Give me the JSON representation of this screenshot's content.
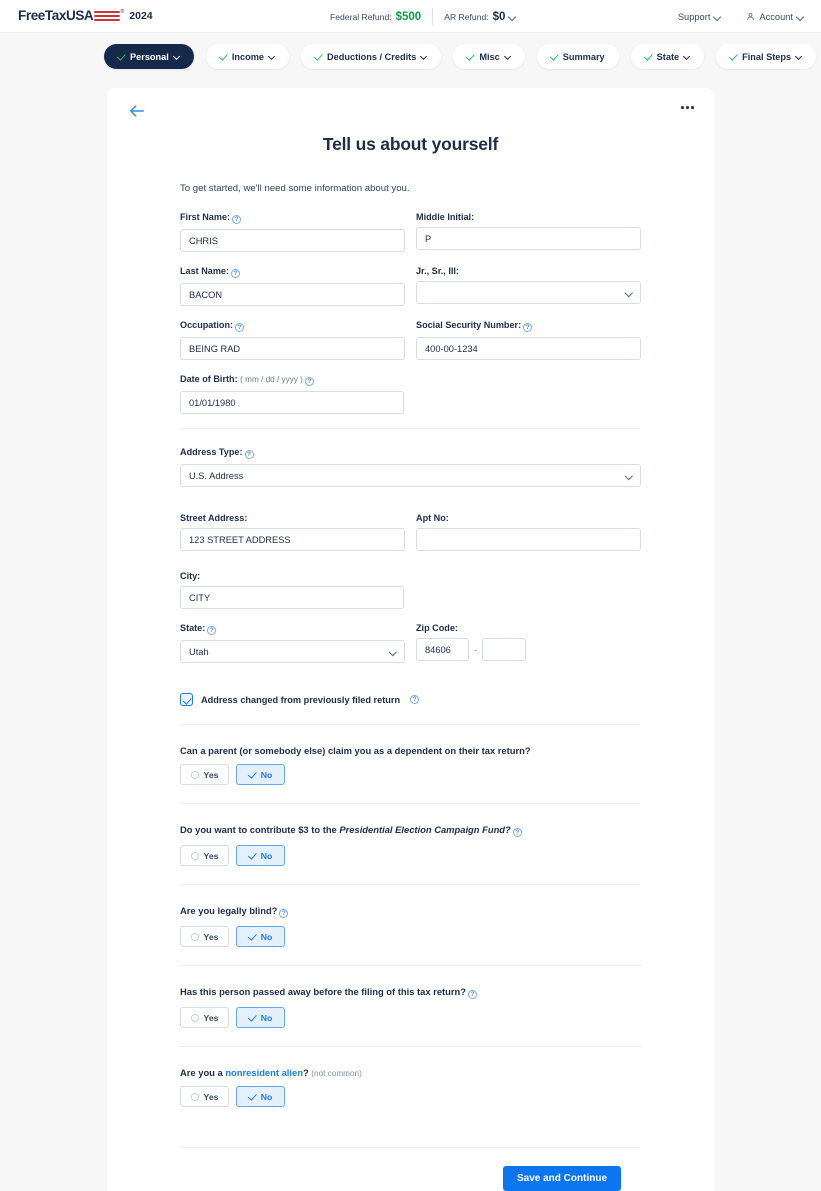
{
  "header": {
    "logo_text": "FreeTaxUSA",
    "logo_icon": "usa-flag-stripes-icon",
    "tax_year": "2024",
    "federal_refund_label": "Federal Refund:",
    "federal_refund_value": "$500",
    "state_refund_label": "AR Refund:",
    "state_refund_value": "$0",
    "support_label": "Support",
    "account_label": "Account",
    "account_icon": "person-icon",
    "federal_refund_color": "#0aa245"
  },
  "steps": [
    {
      "label": "Personal",
      "active": true,
      "check": true,
      "chevron": true
    },
    {
      "label": "Income",
      "active": false,
      "check": true,
      "chevron": true
    },
    {
      "label": "Deductions / Credits",
      "active": false,
      "check": true,
      "chevron": true
    },
    {
      "label": "Misc",
      "active": false,
      "check": true,
      "chevron": true
    },
    {
      "label": "Summary",
      "active": false,
      "check": true,
      "chevron": false
    },
    {
      "label": "State",
      "active": false,
      "check": true,
      "chevron": true
    },
    {
      "label": "Final Steps",
      "active": false,
      "check": true,
      "chevron": true
    }
  ],
  "card": {
    "back_icon": "back-arrow-icon",
    "menu_icon": "ellipsis-icon",
    "title": "Tell us about yourself",
    "intro": "To get started, we'll need some information about you."
  },
  "fields": {
    "first_name": {
      "label": "First Name:",
      "value": "CHRIS",
      "help": true
    },
    "middle_init": {
      "label": "Middle Initial:",
      "value": "P",
      "help": false
    },
    "last_name": {
      "label": "Last Name:",
      "value": "BACON",
      "help": true
    },
    "suffix": {
      "label": "Jr., Sr., III:",
      "value": "",
      "help": false
    },
    "occupation": {
      "label": "Occupation:",
      "value": "BEING RAD",
      "help": true
    },
    "ssn": {
      "label": "Social Security Number:",
      "value": "400-00-1234",
      "help": true
    },
    "dob": {
      "label": "Date of Birth:",
      "hint": "( mm / dd / yyyy )",
      "value": "01/01/1980",
      "help": true
    },
    "address_type": {
      "label": "Address Type:",
      "value": "U.S. Address",
      "help": true
    },
    "street": {
      "label": "Street Address:",
      "value": "123 STREET ADDRESS",
      "help": false
    },
    "apt": {
      "label": "Apt No:",
      "value": "",
      "help": false
    },
    "city": {
      "label": "City:",
      "value": "CITY",
      "help": false
    },
    "state": {
      "label": "State:",
      "value": "Utah",
      "help": true
    },
    "zip": {
      "label": "Zip Code:",
      "value": "84606",
      "value2": "",
      "dash": "-",
      "help": false
    }
  },
  "address_changed": {
    "label": "Address changed from previously filed return",
    "checked": true
  },
  "questions": [
    {
      "text": "Can a parent (or somebody else) claim you as a dependent on their tax return?",
      "help": false,
      "yes_label": "Yes",
      "no_label": "No",
      "selected": "No"
    },
    {
      "text_pre": "Do you want to contribute $3 to the ",
      "text_em": "Presidential Election Campaign Fund?",
      "help": true,
      "yes_label": "Yes",
      "no_label": "No",
      "selected": "No"
    },
    {
      "text": "Are you legally blind?",
      "help": true,
      "yes_label": "Yes",
      "no_label": "No",
      "selected": "No"
    },
    {
      "text": "Has this person passed away before the filing of this tax return?",
      "help": true,
      "yes_label": "Yes",
      "no_label": "No",
      "selected": "No"
    },
    {
      "text_pre": "Are you a ",
      "text_link": "nonresident alien",
      "text_post": "?",
      "text_small": "(not common)",
      "help": false,
      "yes_label": "Yes",
      "no_label": "No",
      "selected": "No"
    }
  ],
  "footer": {
    "save_label": "Save and Continue",
    "accent_color": "#0b76ef"
  }
}
